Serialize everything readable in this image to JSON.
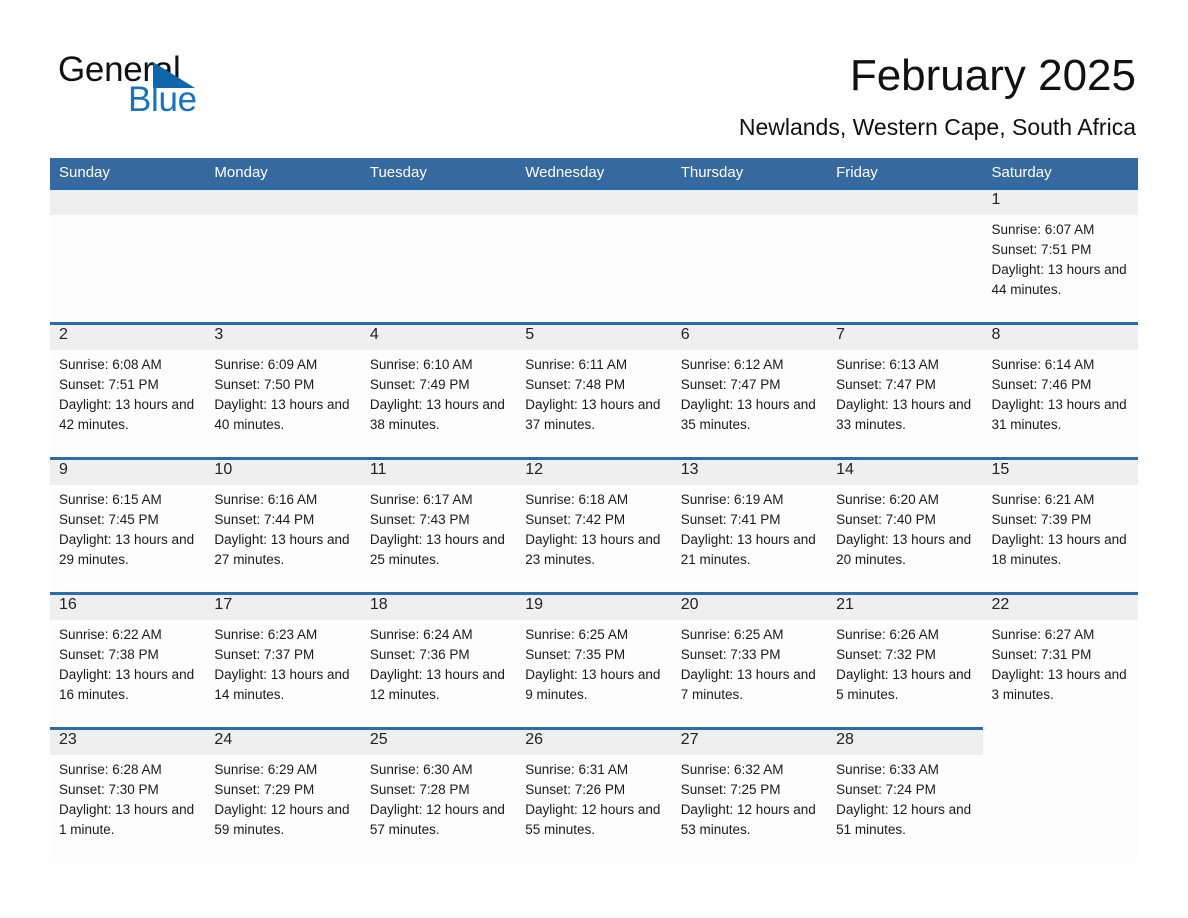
{
  "logo": {
    "line1": "General",
    "line2": "Blue",
    "triangle_color": "#1166ab"
  },
  "header": {
    "title": "February 2025",
    "subtitle": "Newlands, Western Cape, South Africa"
  },
  "colors": {
    "header_blue": "#36699e",
    "row_rule_blue": "#2b6cab",
    "daynum_strip": "#efefef",
    "logo_blue": "#1a72b8"
  },
  "weekdays": [
    "Sunday",
    "Monday",
    "Tuesday",
    "Wednesday",
    "Thursday",
    "Friday",
    "Saturday"
  ],
  "weeks": [
    [
      {
        "day": "",
        "sunrise": "",
        "sunset": "",
        "daylight": "",
        "empty": true
      },
      {
        "day": "",
        "sunrise": "",
        "sunset": "",
        "daylight": "",
        "empty": true
      },
      {
        "day": "",
        "sunrise": "",
        "sunset": "",
        "daylight": "",
        "empty": true
      },
      {
        "day": "",
        "sunrise": "",
        "sunset": "",
        "daylight": "",
        "empty": true
      },
      {
        "day": "",
        "sunrise": "",
        "sunset": "",
        "daylight": "",
        "empty": true
      },
      {
        "day": "",
        "sunrise": "",
        "sunset": "",
        "daylight": "",
        "empty": true
      },
      {
        "day": "1",
        "sunrise": "Sunrise: 6:07 AM",
        "sunset": "Sunset: 7:51 PM",
        "daylight": "Daylight: 13 hours and 44 minutes."
      }
    ],
    [
      {
        "day": "2",
        "sunrise": "Sunrise: 6:08 AM",
        "sunset": "Sunset: 7:51 PM",
        "daylight": "Daylight: 13 hours and 42 minutes."
      },
      {
        "day": "3",
        "sunrise": "Sunrise: 6:09 AM",
        "sunset": "Sunset: 7:50 PM",
        "daylight": "Daylight: 13 hours and 40 minutes."
      },
      {
        "day": "4",
        "sunrise": "Sunrise: 6:10 AM",
        "sunset": "Sunset: 7:49 PM",
        "daylight": "Daylight: 13 hours and 38 minutes."
      },
      {
        "day": "5",
        "sunrise": "Sunrise: 6:11 AM",
        "sunset": "Sunset: 7:48 PM",
        "daylight": "Daylight: 13 hours and 37 minutes."
      },
      {
        "day": "6",
        "sunrise": "Sunrise: 6:12 AM",
        "sunset": "Sunset: 7:47 PM",
        "daylight": "Daylight: 13 hours and 35 minutes."
      },
      {
        "day": "7",
        "sunrise": "Sunrise: 6:13 AM",
        "sunset": "Sunset: 7:47 PM",
        "daylight": "Daylight: 13 hours and 33 minutes."
      },
      {
        "day": "8",
        "sunrise": "Sunrise: 6:14 AM",
        "sunset": "Sunset: 7:46 PM",
        "daylight": "Daylight: 13 hours and 31 minutes."
      }
    ],
    [
      {
        "day": "9",
        "sunrise": "Sunrise: 6:15 AM",
        "sunset": "Sunset: 7:45 PM",
        "daylight": "Daylight: 13 hours and 29 minutes."
      },
      {
        "day": "10",
        "sunrise": "Sunrise: 6:16 AM",
        "sunset": "Sunset: 7:44 PM",
        "daylight": "Daylight: 13 hours and 27 minutes."
      },
      {
        "day": "11",
        "sunrise": "Sunrise: 6:17 AM",
        "sunset": "Sunset: 7:43 PM",
        "daylight": "Daylight: 13 hours and 25 minutes."
      },
      {
        "day": "12",
        "sunrise": "Sunrise: 6:18 AM",
        "sunset": "Sunset: 7:42 PM",
        "daylight": "Daylight: 13 hours and 23 minutes."
      },
      {
        "day": "13",
        "sunrise": "Sunrise: 6:19 AM",
        "sunset": "Sunset: 7:41 PM",
        "daylight": "Daylight: 13 hours and 21 minutes."
      },
      {
        "day": "14",
        "sunrise": "Sunrise: 6:20 AM",
        "sunset": "Sunset: 7:40 PM",
        "daylight": "Daylight: 13 hours and 20 minutes."
      },
      {
        "day": "15",
        "sunrise": "Sunrise: 6:21 AM",
        "sunset": "Sunset: 7:39 PM",
        "daylight": "Daylight: 13 hours and 18 minutes."
      }
    ],
    [
      {
        "day": "16",
        "sunrise": "Sunrise: 6:22 AM",
        "sunset": "Sunset: 7:38 PM",
        "daylight": "Daylight: 13 hours and 16 minutes."
      },
      {
        "day": "17",
        "sunrise": "Sunrise: 6:23 AM",
        "sunset": "Sunset: 7:37 PM",
        "daylight": "Daylight: 13 hours and 14 minutes."
      },
      {
        "day": "18",
        "sunrise": "Sunrise: 6:24 AM",
        "sunset": "Sunset: 7:36 PM",
        "daylight": "Daylight: 13 hours and 12 minutes."
      },
      {
        "day": "19",
        "sunrise": "Sunrise: 6:25 AM",
        "sunset": "Sunset: 7:35 PM",
        "daylight": "Daylight: 13 hours and 9 minutes."
      },
      {
        "day": "20",
        "sunrise": "Sunrise: 6:25 AM",
        "sunset": "Sunset: 7:33 PM",
        "daylight": "Daylight: 13 hours and 7 minutes."
      },
      {
        "day": "21",
        "sunrise": "Sunrise: 6:26 AM",
        "sunset": "Sunset: 7:32 PM",
        "daylight": "Daylight: 13 hours and 5 minutes."
      },
      {
        "day": "22",
        "sunrise": "Sunrise: 6:27 AM",
        "sunset": "Sunset: 7:31 PM",
        "daylight": "Daylight: 13 hours and 3 minutes."
      }
    ],
    [
      {
        "day": "23",
        "sunrise": "Sunrise: 6:28 AM",
        "sunset": "Sunset: 7:30 PM",
        "daylight": "Daylight: 13 hours and 1 minute."
      },
      {
        "day": "24",
        "sunrise": "Sunrise: 6:29 AM",
        "sunset": "Sunset: 7:29 PM",
        "daylight": "Daylight: 12 hours and 59 minutes."
      },
      {
        "day": "25",
        "sunrise": "Sunrise: 6:30 AM",
        "sunset": "Sunset: 7:28 PM",
        "daylight": "Daylight: 12 hours and 57 minutes."
      },
      {
        "day": "26",
        "sunrise": "Sunrise: 6:31 AM",
        "sunset": "Sunset: 7:26 PM",
        "daylight": "Daylight: 12 hours and 55 minutes."
      },
      {
        "day": "27",
        "sunrise": "Sunrise: 6:32 AM",
        "sunset": "Sunset: 7:25 PM",
        "daylight": "Daylight: 12 hours and 53 minutes."
      },
      {
        "day": "28",
        "sunrise": "Sunrise: 6:33 AM",
        "sunset": "Sunset: 7:24 PM",
        "daylight": "Daylight: 12 hours and 51 minutes."
      },
      {
        "day": "",
        "sunrise": "",
        "sunset": "",
        "daylight": "",
        "empty": true
      }
    ]
  ]
}
